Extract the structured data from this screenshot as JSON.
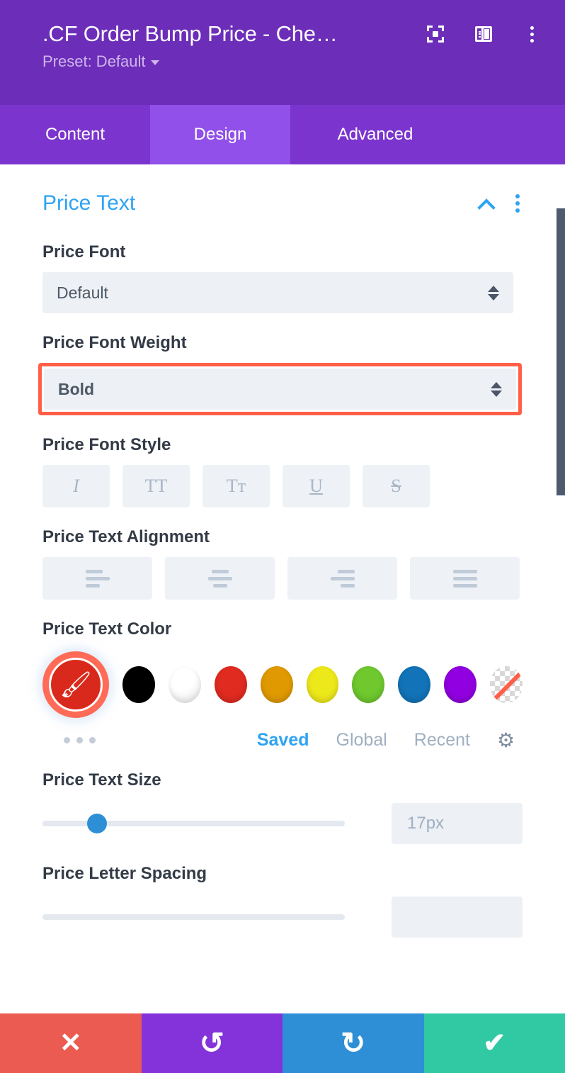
{
  "header": {
    "module_title": ".CF Order Bump Price - Che…",
    "preset_label": "Preset: Default",
    "icons": {
      "focus": "focus-target-icon",
      "panel": "layout-panel-icon",
      "menu": "vertical-dots-icon"
    },
    "background_color": "#6C2EB9"
  },
  "tabs": [
    {
      "label": "Content",
      "active": false
    },
    {
      "label": "Design",
      "active": true
    },
    {
      "label": "Advanced",
      "active": false
    }
  ],
  "tab_bar": {
    "background": "#7B35CE",
    "active_background": "#9050E9"
  },
  "section": {
    "title": "Price Text",
    "title_color": "#2EA3F2",
    "collapse_icon": "chevron-up-icon",
    "menu_icon": "vertical-dots-icon"
  },
  "fields": {
    "price_font": {
      "label": "Price Font",
      "value": "Default"
    },
    "price_font_weight": {
      "label": "Price Font Weight",
      "value": "Bold",
      "highlighted": true,
      "highlight_color": "#FF5F48"
    },
    "price_font_style": {
      "label": "Price Font Style",
      "buttons": [
        {
          "name": "italic",
          "glyph": "I"
        },
        {
          "name": "uppercase",
          "glyph": "TT"
        },
        {
          "name": "small-caps",
          "glyph": "Tт"
        },
        {
          "name": "underline",
          "glyph": "U"
        },
        {
          "name": "strikethrough",
          "glyph": "S"
        }
      ]
    },
    "price_text_alignment": {
      "label": "Price Text Alignment",
      "buttons": [
        {
          "name": "align-left"
        },
        {
          "name": "align-center"
        },
        {
          "name": "align-right"
        },
        {
          "name": "align-justify"
        }
      ]
    },
    "price_text_color": {
      "label": "Price Text Color",
      "selected_tool": "eyedropper",
      "selected_color": "#D9291C",
      "swatches": [
        {
          "name": "black",
          "hex": "#000000"
        },
        {
          "name": "white",
          "hex": "#FFFFFF"
        },
        {
          "name": "red",
          "hex": "#E02B20"
        },
        {
          "name": "amber",
          "hex": "#E09900"
        },
        {
          "name": "yellow",
          "hex": "#EDE81A"
        },
        {
          "name": "green",
          "hex": "#6EC82E"
        },
        {
          "name": "blue",
          "hex": "#1273B8"
        },
        {
          "name": "purple",
          "hex": "#9100E0"
        },
        {
          "name": "transparent",
          "hex": "transparent"
        }
      ],
      "more_icon": "horizontal-dots-icon",
      "palette_tabs": [
        {
          "label": "Saved",
          "active": true
        },
        {
          "label": "Global",
          "active": false
        },
        {
          "label": "Recent",
          "active": false
        }
      ],
      "settings_icon": "gear-icon"
    },
    "price_text_size": {
      "label": "Price Text Size",
      "value": "17px",
      "slider_percent": 18
    },
    "price_letter_spacing": {
      "label": "Price Letter Spacing"
    }
  },
  "scrollbar": {
    "color": "#4E5B6E"
  },
  "bottom_bar": {
    "buttons": [
      {
        "name": "cancel",
        "glyph": "✕",
        "color": "#EB5B51"
      },
      {
        "name": "undo",
        "glyph": "↺",
        "color": "#8333D9"
      },
      {
        "name": "redo",
        "glyph": "↻",
        "color": "#2E8FD6"
      },
      {
        "name": "save",
        "glyph": "✔",
        "color": "#31C9A3"
      }
    ]
  }
}
